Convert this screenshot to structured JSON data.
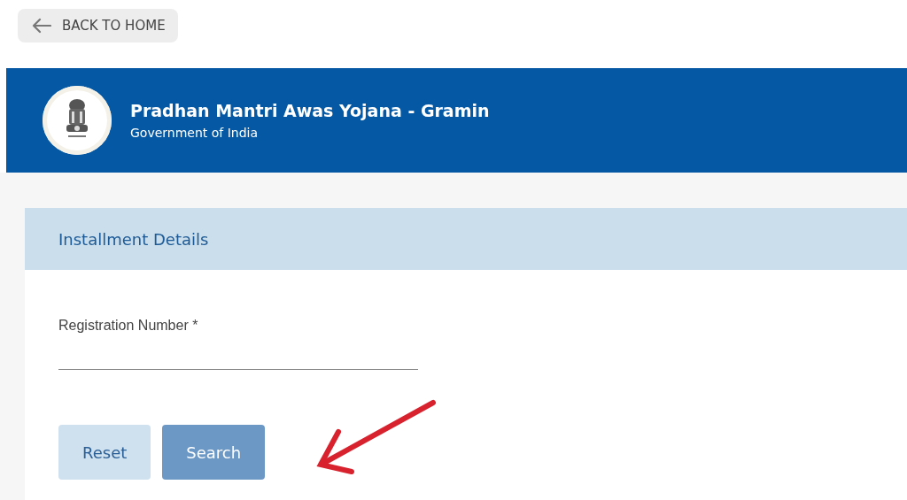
{
  "back_button": {
    "label": "BACK TO HOME"
  },
  "header": {
    "title": "Pradhan Mantri Awas Yojana - Gramin",
    "subtitle": "Government of India"
  },
  "card": {
    "title": "Installment Details",
    "field": {
      "label": "Registration Number *"
    },
    "buttons": [
      {
        "label": "Reset",
        "kind": "secondary",
        "disabled": false
      },
      {
        "label": "Search",
        "kind": "primary",
        "disabled": true
      }
    ]
  }
}
